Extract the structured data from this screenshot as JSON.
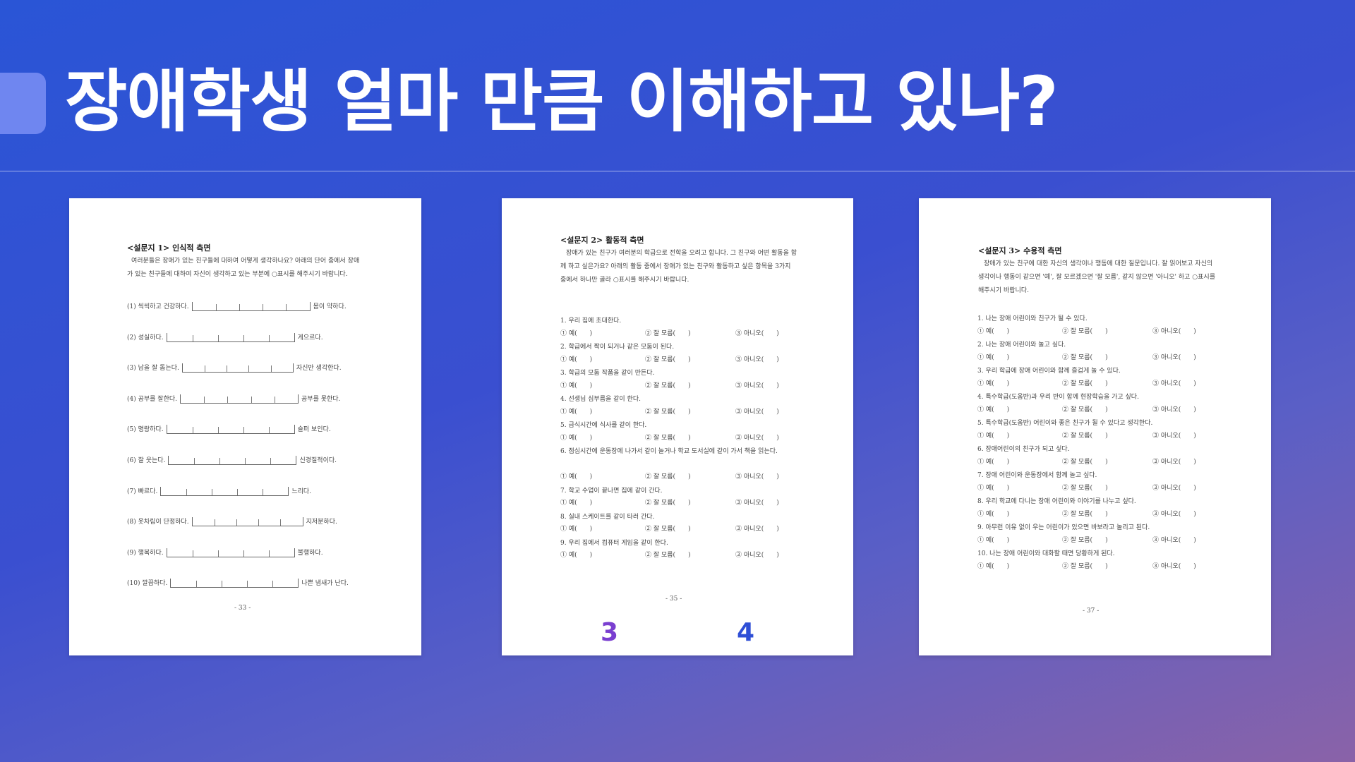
{
  "slide": {
    "title": "장애학생 얼마 만큼 이해하고 있나?"
  },
  "survey1": {
    "title": "<설문지 1> 인식적 측면",
    "intro": "여러분들은 장애가 있는 친구들에 대하여 어떻게 생각하나요? 아래의 단어 중에서 장애가 있는 친구들에 대하여 자신이 생각하고 있는 부분에 ○표시를 해주시기 바랍니다.",
    "items": [
      {
        "left": "(1) 씩씩하고 건강하다.",
        "right": "몸이 약하다."
      },
      {
        "left": "(2) 성실하다.",
        "right": "게으르다."
      },
      {
        "left": "(3) 남을 잘 돕는다.",
        "right": "자신만 생각한다."
      },
      {
        "left": "(4) 공부를 잘한다.",
        "right": "공부를 못한다."
      },
      {
        "left": "(5) 명랑하다.",
        "right": "슬퍼 보인다."
      },
      {
        "left": "(6) 잘 웃는다.",
        "right": "신경질적이다."
      },
      {
        "left": "(7) 빠르다.",
        "right": "느리다."
      },
      {
        "left": "(8) 옷차림이 단정하다.",
        "right": "지저분하다."
      },
      {
        "left": "(9) 행복하다.",
        "right": "불행하다."
      },
      {
        "left": "(10) 깔끔하다.",
        "right": "나쁜 냄새가 난다."
      }
    ],
    "page_number": "- 33 -"
  },
  "survey2": {
    "title": "<설문지 2> 활동적 측면",
    "intro": "장애가 있는 친구가 여러분의 학급으로 전학을 오려고 합니다. 그 친구와 어떤 활동을 함께 하고 싶은가요? 아래의 활동 중에서 장애가 있는 친구와 활동하고 싶은 항목을 3가지 중에서 하나만 골라 ○표시를 해주시기 바랍니다.",
    "items": [
      "1. 우리 집에 초대한다.",
      "2. 학급에서 짝이 되거나 같은 모둠이 된다.",
      "3. 학급의 모둠 작품을 같이 만든다.",
      "4. 선생님 심부름을 같이 한다.",
      "5. 급식시간에 식사를 같이 한다.",
      "6. 점심시간에 운동장에 나가서 같이 놀거나 학교 도서실에 같이 가서 책을 읽는다.",
      "7. 학교 수업이 끝나면 집에 같이 간다.",
      "8. 실내 스케이트를 같이 타러 간다.",
      "9. 우리 집에서 컴퓨터 게임을 같이 한다."
    ],
    "options": [
      "① 예(　　)",
      "② 잘 모름(　　)",
      "③ 아니오(　　)"
    ],
    "page_number": "- 35 -"
  },
  "survey3": {
    "title": "<설문지 3> 수용적 측면",
    "intro": "장애가 있는 친구에 대한 자신의 생각이나 행동에 대한 질문입니다. 잘 읽어보고 자신의 생각이나 행동이 같으면 '예', 잘 모르겠으면 '잘 모름', 같지 않으면 '아니오' 하고 ○표시를 해주시기 바랍니다.",
    "items": [
      "1. 나는 장애 어린이와 친구가 될 수 있다.",
      "2. 나는 장애 어린이와 놀고 싶다.",
      "3. 우리 학급에 장애 어린이와 함께 즐겁게 놀 수 있다.",
      "4. 특수학급(도움반)과 우리 반이 함께 현장학습을 가고 싶다.",
      "5. 특수학급(도움반) 어린이와 좋은 친구가 될 수 있다고 생각한다.",
      "6. 장애어린이의 친구가 되고 싶다.",
      "7. 장애 어린이와 운동장에서 함께 놀고 싶다.",
      "8. 우리 학교에 다니는 장애 어린이와 이야기를 나누고 싶다.",
      "9. 아무런 이유 없이 우는 어린이가 있으면 바보라고 놀리고 된다.",
      "10. 나는 장애 어린이와 대화할 때면 당황하게 된다."
    ],
    "options": [
      "① 예(　　)",
      "② 잘 모름(　　)",
      "③ 아니오(　　)"
    ],
    "page_number": "- 37 -"
  },
  "markers": {
    "m3": "3",
    "m4": "4",
    "m3_color": "#7a3fd0",
    "m4_color": "#2f4fd6"
  }
}
